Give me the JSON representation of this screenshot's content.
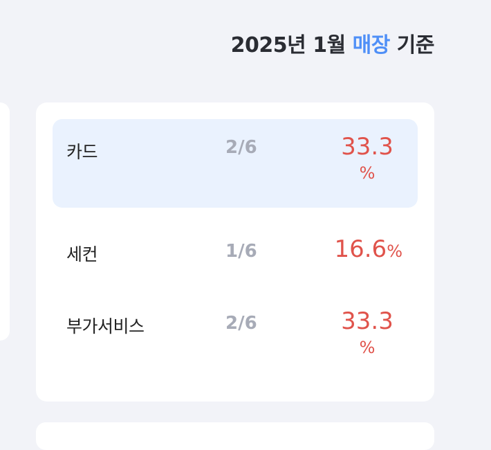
{
  "header": {
    "prefix": "2025년 1월",
    "accent": "매장",
    "suffix": "기준"
  },
  "rows": [
    {
      "label": "카드",
      "ratio": "2/6",
      "percent": "33.3",
      "unit": "%"
    },
    {
      "label": "세컨",
      "ratio": "1/6",
      "percent": "16.6",
      "unit": "%"
    },
    {
      "label": "부가서비스",
      "ratio": "2/6",
      "percent": "33.3",
      "unit": "%"
    }
  ],
  "colors": {
    "accent": "#4f8ff7",
    "percent": "#e0534b",
    "ratio": "#a7abb7",
    "highlight": "#eaf2fe"
  }
}
